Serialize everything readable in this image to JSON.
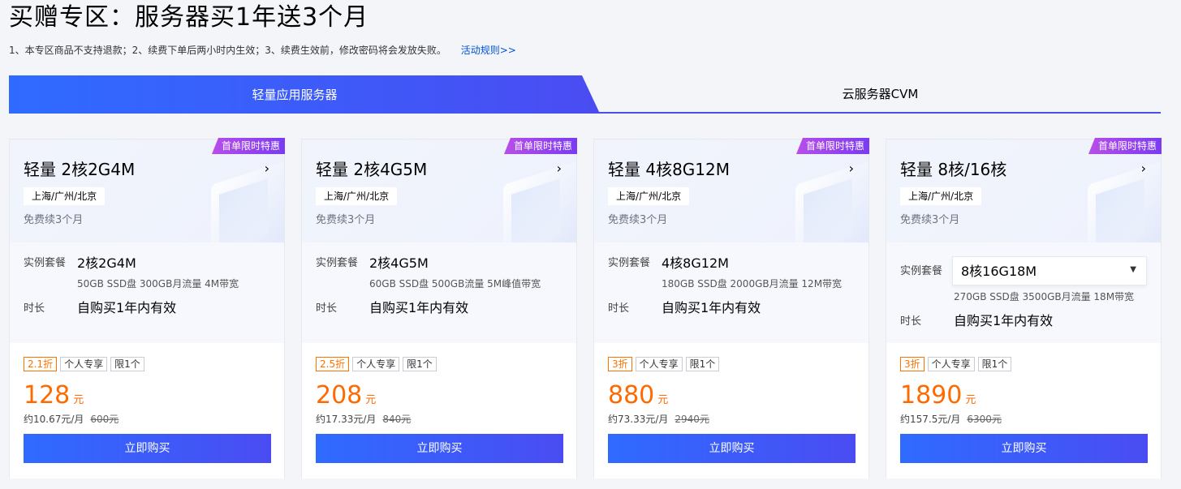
{
  "page": {
    "title": "买赠专区：服务器买1年送3个月",
    "notice": "1、本专区商品不支持退款；2、续费下单后两小时内生效；3、续费生效前，修改密码将会发放失败。",
    "rules_link": "活动规则>>"
  },
  "tabs": [
    {
      "label": "轻量应用服务器",
      "active": true
    },
    {
      "label": "云服务器CVM",
      "active": false
    }
  ],
  "colors": {
    "accent": "#3d5afe",
    "price": "#ff6a00",
    "badge": "#8a3ff0"
  },
  "cards": [
    {
      "badge": "首单限时特惠",
      "title": "轻量 2核2G4M",
      "arrow": "›",
      "region": "上海/广州/北京",
      "free_note": "免费续3个月",
      "spec_label": "实例套餐",
      "spec_value": "2核2G4M",
      "spec_detail": "50GB SSD盘 300GB月流量 4M带宽",
      "duration_label": "时长",
      "duration_value": "自购买1年内有效",
      "tags": [
        "2.1折",
        "个人专享",
        "限1个"
      ],
      "price": "128",
      "price_unit": "元",
      "monthly": "约10.67元/月",
      "original": "600元",
      "buy_label": "立即购买"
    },
    {
      "badge": "首单限时特惠",
      "title": "轻量 2核4G5M",
      "arrow": "›",
      "region": "上海/广州/北京",
      "free_note": "免费续3个月",
      "spec_label": "实例套餐",
      "spec_value": "2核4G5M",
      "spec_detail": "60GB SSD盘 500GB流量 5M峰值带宽",
      "duration_label": "时长",
      "duration_value": "自购买1年内有效",
      "tags": [
        "2.5折",
        "个人专享",
        "限1个"
      ],
      "price": "208",
      "price_unit": "元",
      "monthly": "约17.33元/月",
      "original": "840元",
      "buy_label": "立即购买"
    },
    {
      "badge": "首单限时特惠",
      "title": "轻量 4核8G12M",
      "arrow": "›",
      "region": "上海/广州/北京",
      "free_note": "免费续3个月",
      "spec_label": "实例套餐",
      "spec_value": "4核8G12M",
      "spec_detail": "180GB SSD盘 2000GB月流量 12M带宽",
      "duration_label": "时长",
      "duration_value": "自购买1年内有效",
      "tags": [
        "3折",
        "个人专享",
        "限1个"
      ],
      "price": "880",
      "price_unit": "元",
      "monthly": "约73.33元/月",
      "original": "2940元",
      "buy_label": "立即购买"
    },
    {
      "badge": "首单限时特惠",
      "title": "轻量 8核/16核",
      "arrow": "›",
      "region": "上海/广州/北京",
      "free_note": "免费续3个月",
      "spec_label": "实例套餐",
      "spec_value": "8核16G18M",
      "spec_detail": "270GB SSD盘 3500GB月流量 18M带宽",
      "duration_label": "时长",
      "duration_value": "自购买1年内有效",
      "tags": [
        "3折",
        "个人专享",
        "限1个"
      ],
      "price": "1890",
      "price_unit": "元",
      "monthly": "约157.5元/月",
      "original": "6300元",
      "buy_label": "立即购买"
    }
  ]
}
